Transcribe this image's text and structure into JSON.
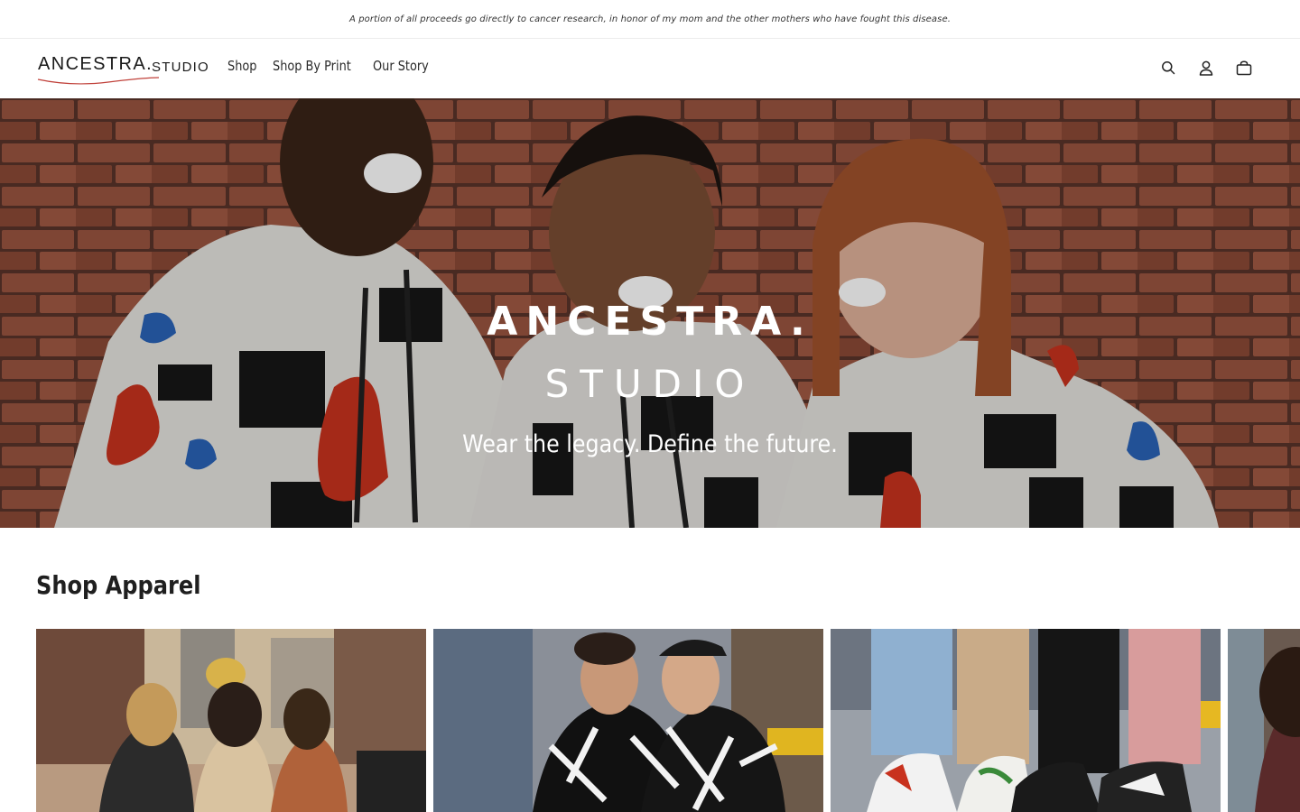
{
  "announcement": {
    "text": "A portion of all proceeds go directly to cancer research, in honor of my mom and the other mothers who have fought this disease."
  },
  "header": {
    "logo_main": "ANCESTRA.",
    "logo_sub": "STUDIO",
    "nav": [
      {
        "label": "Shop"
      },
      {
        "label": "Shop By Print"
      },
      {
        "label": "Our Story"
      }
    ],
    "icons": [
      "search-icon",
      "account-icon",
      "cart-icon"
    ]
  },
  "hero": {
    "title_line1": "ANCESTRA.",
    "title_line2": "STUDIO",
    "tagline": "Wear the legacy. Define the future."
  },
  "shop_apparel": {
    "title": "Shop Apparel",
    "cards": [
      {
        "image": "women-walking-street-photo"
      },
      {
        "image": "men-in-jackets-photo"
      },
      {
        "image": "sneakers-photo"
      },
      {
        "image": "partial-card-photo"
      }
    ]
  },
  "colors": {
    "brick": "#8a4a34",
    "hoodie": "#e8e6e2",
    "accent_red": "#c8321e",
    "accent_blue": "#2a63b8"
  }
}
